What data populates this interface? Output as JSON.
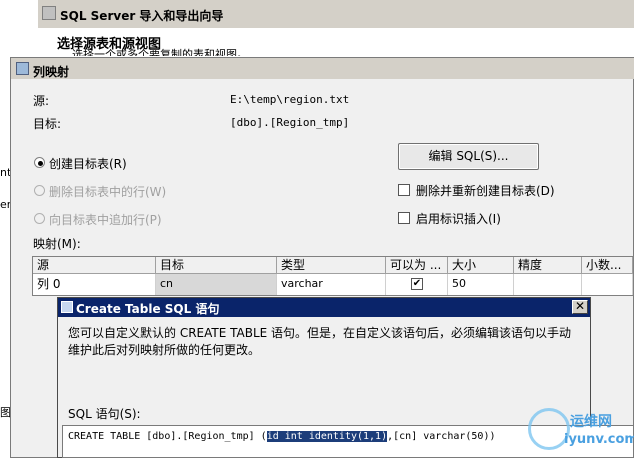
{
  "wizard": {
    "title": "SQL Server 导入和导出向导",
    "heading": "选择源表和源视图",
    "subheading": "选择一个或多个要复制的表和视图。",
    "edge_labels": [
      "nt",
      "er",
      "图"
    ]
  },
  "mapping_dialog": {
    "title": "列映射",
    "source_label": "源:",
    "source_value": "E:\\temp\\region.txt",
    "dest_label": "目标:",
    "dest_value": "[dbo].[Region_tmp]",
    "options": {
      "create_table": "创建目标表(R)",
      "delete_rows": "删除目标表中的行(W)",
      "append_rows": "向目标表中追加行(P)",
      "selected": "create_table"
    },
    "edit_sql_button": "编辑 SQL(S)...",
    "drop_recreate": "删除并重新创建目标表(D)",
    "enable_identity_insert": "启用标识插入(I)",
    "mappings_label": "映射(M):",
    "grid": {
      "columns": [
        "源",
        "目标",
        "类型",
        "可以为 ...",
        "大小",
        "精度",
        "小数..."
      ],
      "rows": [
        {
          "source": "列 0",
          "target": "cn",
          "type": "varchar",
          "nullable": "✔",
          "size": "50",
          "precision": "",
          "scale": ""
        }
      ]
    }
  },
  "sql_dialog": {
    "title": "Create Table SQL 语句",
    "close_glyph": "✕",
    "description": "您可以自定义默认的 CREATE TABLE 语句。但是，在自定义该语句后，必须编辑该语句以手动维护此后对列映射所做的任何更改。",
    "sql_label": "SQL 语句(S):",
    "sql_prefix": "CREATE TABLE [dbo].[Region_tmp] (",
    "sql_selected": "id int identity(1,1)",
    "sql_suffix": ",[cn] varchar(50))"
  },
  "watermark": {
    "line1": "运维网",
    "line2": "iyunv.com"
  }
}
